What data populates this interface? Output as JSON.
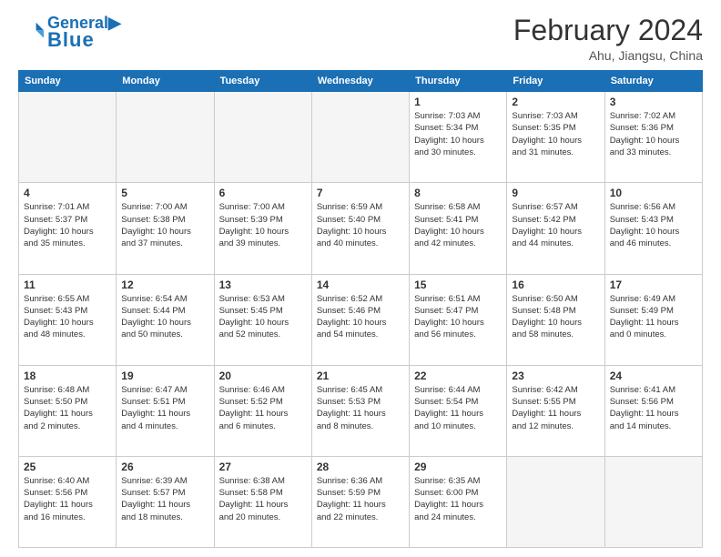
{
  "logo": {
    "line1": "General",
    "line2": "Blue"
  },
  "title": "February 2024",
  "subtitle": "Ahu, Jiangsu, China",
  "days_header": [
    "Sunday",
    "Monday",
    "Tuesday",
    "Wednesday",
    "Thursday",
    "Friday",
    "Saturday"
  ],
  "weeks": [
    [
      {
        "num": "",
        "info": ""
      },
      {
        "num": "",
        "info": ""
      },
      {
        "num": "",
        "info": ""
      },
      {
        "num": "",
        "info": ""
      },
      {
        "num": "1",
        "info": "Sunrise: 7:03 AM\nSunset: 5:34 PM\nDaylight: 10 hours\nand 30 minutes."
      },
      {
        "num": "2",
        "info": "Sunrise: 7:03 AM\nSunset: 5:35 PM\nDaylight: 10 hours\nand 31 minutes."
      },
      {
        "num": "3",
        "info": "Sunrise: 7:02 AM\nSunset: 5:36 PM\nDaylight: 10 hours\nand 33 minutes."
      }
    ],
    [
      {
        "num": "4",
        "info": "Sunrise: 7:01 AM\nSunset: 5:37 PM\nDaylight: 10 hours\nand 35 minutes."
      },
      {
        "num": "5",
        "info": "Sunrise: 7:00 AM\nSunset: 5:38 PM\nDaylight: 10 hours\nand 37 minutes."
      },
      {
        "num": "6",
        "info": "Sunrise: 7:00 AM\nSunset: 5:39 PM\nDaylight: 10 hours\nand 39 minutes."
      },
      {
        "num": "7",
        "info": "Sunrise: 6:59 AM\nSunset: 5:40 PM\nDaylight: 10 hours\nand 40 minutes."
      },
      {
        "num": "8",
        "info": "Sunrise: 6:58 AM\nSunset: 5:41 PM\nDaylight: 10 hours\nand 42 minutes."
      },
      {
        "num": "9",
        "info": "Sunrise: 6:57 AM\nSunset: 5:42 PM\nDaylight: 10 hours\nand 44 minutes."
      },
      {
        "num": "10",
        "info": "Sunrise: 6:56 AM\nSunset: 5:43 PM\nDaylight: 10 hours\nand 46 minutes."
      }
    ],
    [
      {
        "num": "11",
        "info": "Sunrise: 6:55 AM\nSunset: 5:43 PM\nDaylight: 10 hours\nand 48 minutes."
      },
      {
        "num": "12",
        "info": "Sunrise: 6:54 AM\nSunset: 5:44 PM\nDaylight: 10 hours\nand 50 minutes."
      },
      {
        "num": "13",
        "info": "Sunrise: 6:53 AM\nSunset: 5:45 PM\nDaylight: 10 hours\nand 52 minutes."
      },
      {
        "num": "14",
        "info": "Sunrise: 6:52 AM\nSunset: 5:46 PM\nDaylight: 10 hours\nand 54 minutes."
      },
      {
        "num": "15",
        "info": "Sunrise: 6:51 AM\nSunset: 5:47 PM\nDaylight: 10 hours\nand 56 minutes."
      },
      {
        "num": "16",
        "info": "Sunrise: 6:50 AM\nSunset: 5:48 PM\nDaylight: 10 hours\nand 58 minutes."
      },
      {
        "num": "17",
        "info": "Sunrise: 6:49 AM\nSunset: 5:49 PM\nDaylight: 11 hours\nand 0 minutes."
      }
    ],
    [
      {
        "num": "18",
        "info": "Sunrise: 6:48 AM\nSunset: 5:50 PM\nDaylight: 11 hours\nand 2 minutes."
      },
      {
        "num": "19",
        "info": "Sunrise: 6:47 AM\nSunset: 5:51 PM\nDaylight: 11 hours\nand 4 minutes."
      },
      {
        "num": "20",
        "info": "Sunrise: 6:46 AM\nSunset: 5:52 PM\nDaylight: 11 hours\nand 6 minutes."
      },
      {
        "num": "21",
        "info": "Sunrise: 6:45 AM\nSunset: 5:53 PM\nDaylight: 11 hours\nand 8 minutes."
      },
      {
        "num": "22",
        "info": "Sunrise: 6:44 AM\nSunset: 5:54 PM\nDaylight: 11 hours\nand 10 minutes."
      },
      {
        "num": "23",
        "info": "Sunrise: 6:42 AM\nSunset: 5:55 PM\nDaylight: 11 hours\nand 12 minutes."
      },
      {
        "num": "24",
        "info": "Sunrise: 6:41 AM\nSunset: 5:56 PM\nDaylight: 11 hours\nand 14 minutes."
      }
    ],
    [
      {
        "num": "25",
        "info": "Sunrise: 6:40 AM\nSunset: 5:56 PM\nDaylight: 11 hours\nand 16 minutes."
      },
      {
        "num": "26",
        "info": "Sunrise: 6:39 AM\nSunset: 5:57 PM\nDaylight: 11 hours\nand 18 minutes."
      },
      {
        "num": "27",
        "info": "Sunrise: 6:38 AM\nSunset: 5:58 PM\nDaylight: 11 hours\nand 20 minutes."
      },
      {
        "num": "28",
        "info": "Sunrise: 6:36 AM\nSunset: 5:59 PM\nDaylight: 11 hours\nand 22 minutes."
      },
      {
        "num": "29",
        "info": "Sunrise: 6:35 AM\nSunset: 6:00 PM\nDaylight: 11 hours\nand 24 minutes."
      },
      {
        "num": "",
        "info": ""
      },
      {
        "num": "",
        "info": ""
      }
    ]
  ]
}
